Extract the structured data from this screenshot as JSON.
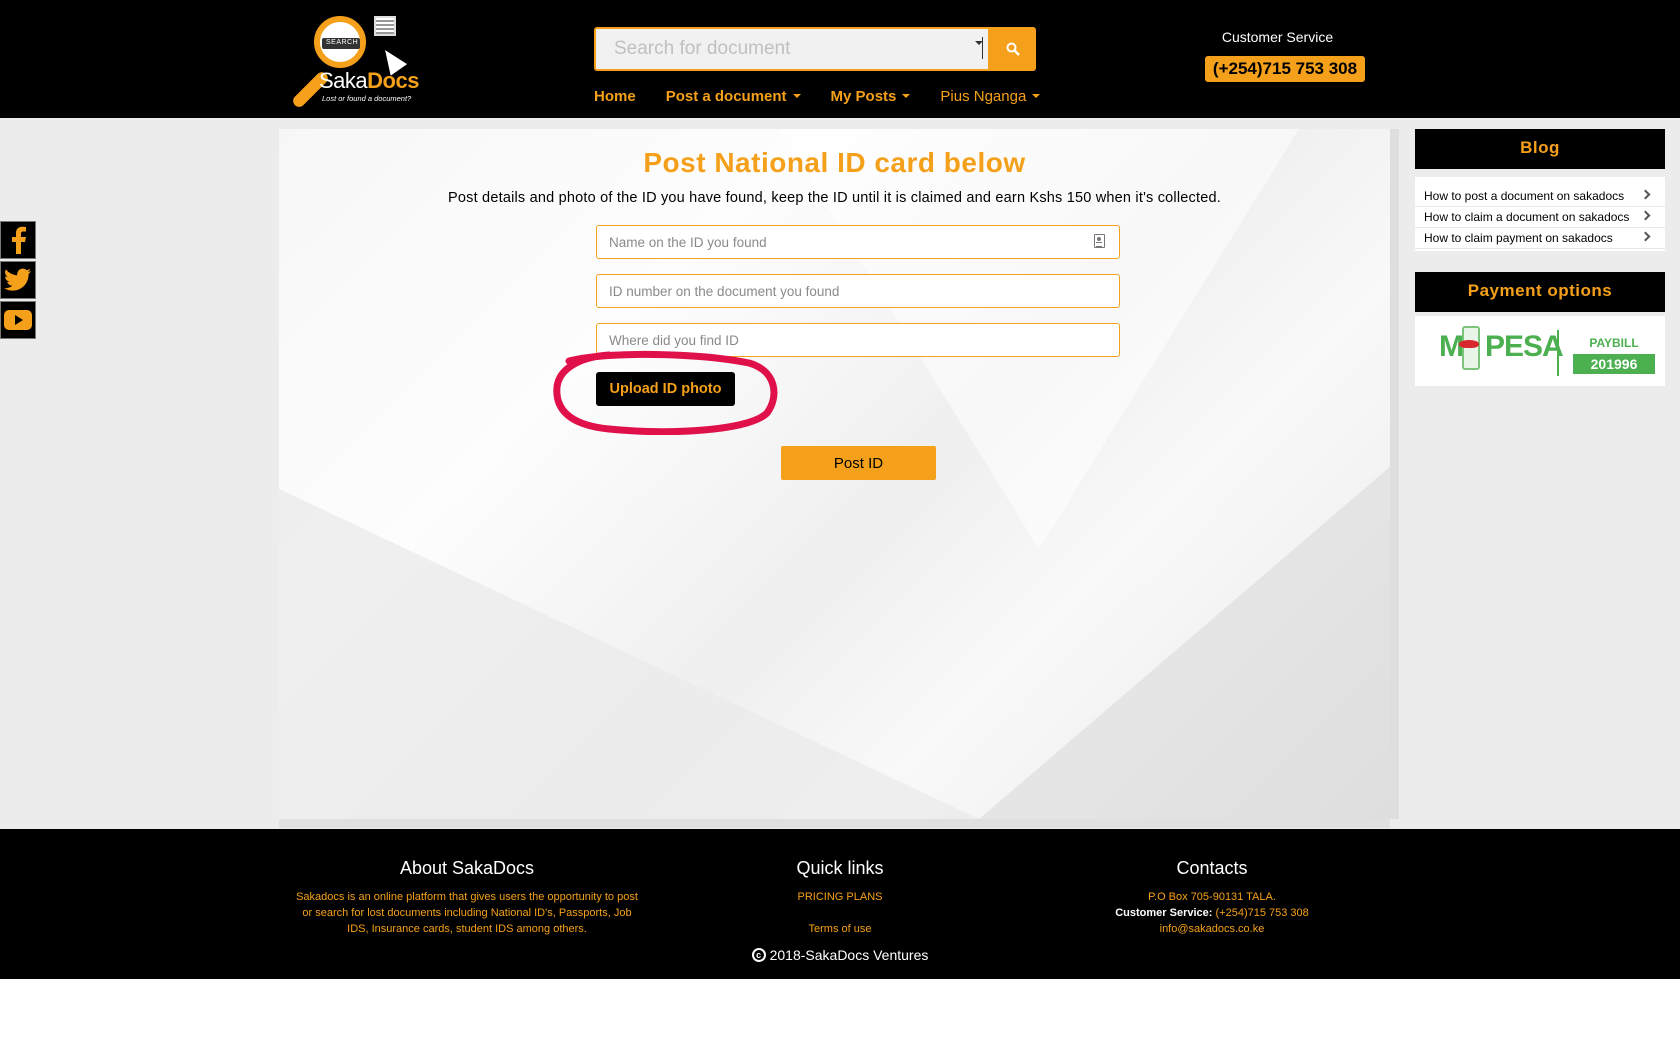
{
  "header": {
    "brand_prefix": "Saka",
    "brand_suffix": "Docs",
    "tagline": "Lost or found a document?",
    "logo_search_text": "SEARCH",
    "search_placeholder": "Search for document",
    "nav": [
      {
        "label": "Home"
      },
      {
        "label": "Post a document"
      },
      {
        "label": "My Posts"
      },
      {
        "label": "Pius Nganga"
      }
    ],
    "customer_service_label": "Customer Service",
    "customer_service_phone": "(+254)715 753 308"
  },
  "social": [
    "facebook-icon",
    "twitter-icon",
    "youtube-icon"
  ],
  "form": {
    "title": "Post National ID card below",
    "subtitle": "Post details and photo of the ID you have found, keep the ID until it is claimed and earn Kshs 150 when it's collected.",
    "name_placeholder": "Name on the ID you found",
    "id_placeholder": "ID number on the document you found",
    "location_placeholder": "Where did you find ID",
    "upload_label": "Upload ID photo",
    "submit_label": "Post ID"
  },
  "sidebar": {
    "blog_title": "Blog",
    "blog_items": [
      {
        "label": "How to post a document on sakadocs"
      },
      {
        "label": "How to claim a document on sakadocs"
      },
      {
        "label": "How to claim payment on sakadocs"
      }
    ],
    "payment_title": "Payment options",
    "mpesa_text": "M-PESA",
    "paybill_label": "PAYBILL",
    "paybill_number": "201996"
  },
  "footer": {
    "about_title": "About SakaDocs",
    "about_text": "Sakadocs is an online platform that gives users the opportunity to post or search for lost documents including National ID's, Passports, Job IDS, Insurance cards, student IDS among others.",
    "quick_title": "Quick links",
    "quick_links": [
      "PRICING PLANS",
      "Terms of use"
    ],
    "contacts_title": "Contacts",
    "address": "P.O Box 705-90131 TALA.",
    "cs_label": "Customer Service:",
    "cs_phone": "(+254)715 753 308",
    "email": "info@sakadocs.co.ke",
    "copyright": "2018-SakaDocs Ventures"
  },
  "colors": {
    "accent": "#f5a01a",
    "header_bg": "#000000",
    "annotation": "#e0104a",
    "mpesa_green": "#4caf50"
  }
}
